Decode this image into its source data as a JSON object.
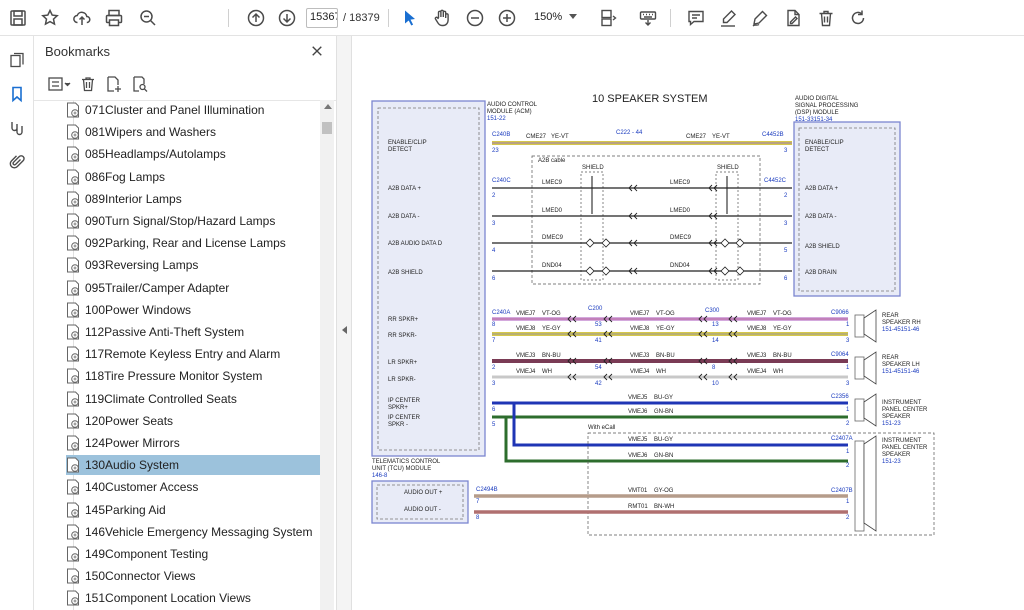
{
  "toolbar": {
    "current_page": "15367",
    "page_total": "/ 18379",
    "zoom": "150%"
  },
  "panel": {
    "title": "Bookmarks"
  },
  "bookmarks": [
    {
      "label": "071Cluster and Panel Illumination",
      "selected": false
    },
    {
      "label": "081Wipers and Washers",
      "selected": false
    },
    {
      "label": "085Headlamps/Autolamps",
      "selected": false
    },
    {
      "label": "086Fog Lamps",
      "selected": false
    },
    {
      "label": "089Interior Lamps",
      "selected": false
    },
    {
      "label": "090Turn Signal/Stop/Hazard Lamps",
      "selected": false
    },
    {
      "label": "092Parking, Rear and License Lamps",
      "selected": false
    },
    {
      "label": "093Reversing Lamps",
      "selected": false
    },
    {
      "label": "095Trailer/Camper Adapter",
      "selected": false
    },
    {
      "label": "100Power Windows",
      "selected": false
    },
    {
      "label": "112Passive Anti-Theft System",
      "selected": false
    },
    {
      "label": "117Remote Keyless Entry and Alarm",
      "selected": false
    },
    {
      "label": "118Tire Pressure Monitor System",
      "selected": false
    },
    {
      "label": "119Climate Controlled Seats",
      "selected": false
    },
    {
      "label": "120Power Seats",
      "selected": false
    },
    {
      "label": "124Power Mirrors",
      "selected": false
    },
    {
      "label": "130Audio System",
      "selected": true
    },
    {
      "label": "140Customer Access",
      "selected": false
    },
    {
      "label": "145Parking Aid",
      "selected": false
    },
    {
      "label": "146Vehicle Emergency Messaging System",
      "selected": false
    },
    {
      "label": "149Component Testing",
      "selected": false
    },
    {
      "label": "150Connector Views",
      "selected": false
    },
    {
      "label": "151Component Location Views",
      "selected": false
    }
  ],
  "diagram": {
    "title": "10 SPEAKER SYSTEM",
    "acm": {
      "name_1": "AUDIO CONTROL",
      "name_2": "MODULE (ACM)",
      "ref": "151-22"
    },
    "dsp": {
      "name_1": "AUDIO DIGITAL",
      "name_2": "SIGNAL PROCESSING",
      "name_3": "(DSP) MODULE",
      "ref": "151-33151-34"
    },
    "tcu": {
      "name_1": "TELEMATICS CONTROL",
      "name_2": "UNIT (TCU) MODULE",
      "ref": "146-8",
      "pin_in": "AUDIO OUT +",
      "pin_out": "AUDIO OUT -"
    },
    "acm_pins": {
      "enable_1": "ENABLE/CLIP",
      "enable_2": "DETECT",
      "data_plus": "A2B DATA +",
      "data_minus": "A2B DATA -",
      "audio_data": "A2B AUDIO DATA D",
      "shield": "A2B SHIELD",
      "rr_plus": "RR SPKR+",
      "rr_minus": "RR SPKR-",
      "lr_plus": "LR SPKR+",
      "lr_minus": "LR SPKR-",
      "ip_plus_1": "IP CENTER",
      "ip_plus_2": "SPKR+",
      "ip_minus_1": "IP CENTER",
      "ip_minus_2": "SPKR -"
    },
    "dsp_pins": {
      "enable_1": "ENABLE/CLIP",
      "enable_2": "DETECT",
      "data_plus": "A2B DATA +",
      "data_minus": "A2B DATA -",
      "shield": "A2B SHIELD",
      "drain": "A2B DRAIN"
    },
    "connectors": {
      "c240b": "C240B",
      "c222": "C222 - 44",
      "c4452b": "C4452B",
      "c240c": "C240C",
      "c4452c": "C4452C",
      "c240a": "C240A",
      "c200": "C200",
      "c300": "C300",
      "c9066": "C9066",
      "c9064": "C9064",
      "c2356": "C2356",
      "c2407a": "C2407A",
      "c2494b": "C2494B",
      "c2407b": "C2407B"
    },
    "cable_label": "A2B cable",
    "shield_label": "SHIELD",
    "with_ecall": "With eCall",
    "wires": {
      "cme27": "CME27",
      "ye_vt": "YE-VT",
      "lmec9": "LMEC9",
      "lmed0": "LMED0",
      "dmec9": "DMEC9",
      "dnd04": "DND04",
      "vmej7": "VMEJ7",
      "vt_og": "VT-OG",
      "vmej8": "VMEJ8",
      "ye_gy": "YE-GY",
      "vmej3": "VMEJ3",
      "bn_bu": "BN-BU",
      "vmej4": "VMEJ4",
      "wh": "WH",
      "vmej5": "VMEJ5",
      "bu_gy": "BU-GY",
      "vmej6": "VMEJ6",
      "gn_bn": "GN-BN",
      "vmt01": "VMT01",
      "gy_og": "GY-OG",
      "rmt01": "RMT01",
      "bn_wh": "BN-WH"
    },
    "speakers": {
      "rear_rh_1": "REAR",
      "rear_rh_2": "SPEAKER RH",
      "rear_rh_ref": "151-45151-46",
      "rear_lh_1": "REAR",
      "rear_lh_2": "SPEAKER LH",
      "rear_lh_ref": "151-45151-46",
      "ipc1_1": "INSTRUMENT",
      "ipc1_2": "PANEL CENTER",
      "ipc1_3": "SPEAKER",
      "ipc1_ref": "151-23",
      "ipc2_1": "INSTRUMENT",
      "ipc2_2": "PANEL CENTER",
      "ipc2_3": "SPEAKER",
      "ipc2_ref": "151-23"
    },
    "pins": {
      "p23": "23",
      "p3": "3",
      "p2": "2",
      "p4": "4",
      "p6": "6",
      "p8": "8",
      "p7": "7",
      "p1": "1",
      "p5": "5",
      "p53": "53",
      "p41": "41",
      "p54": "54",
      "p42": "42",
      "p13": "13",
      "p14": "14",
      "p10": "10"
    }
  }
}
